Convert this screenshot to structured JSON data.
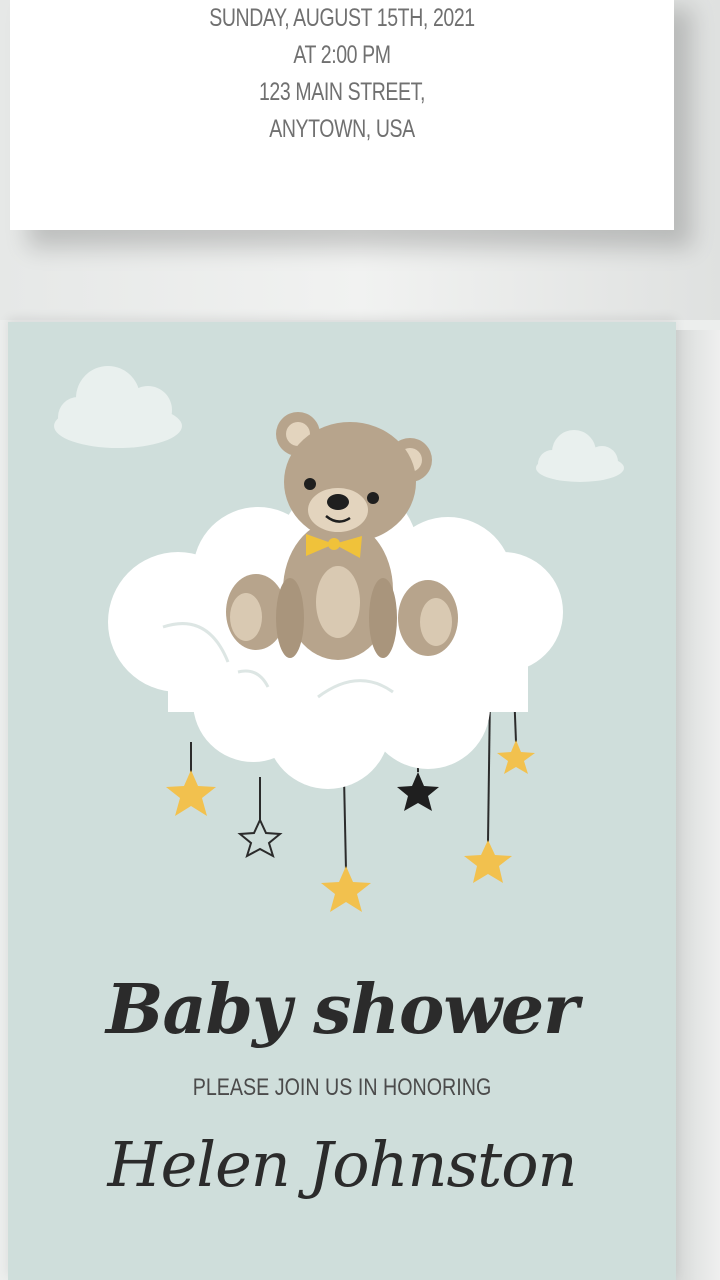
{
  "invitation_back": {
    "lines": [
      "SUNDAY, AUGUST 15TH, 2021",
      "AT 2:00 PM",
      "123 MAIN STREET,",
      "ANYTOWN, USA"
    ]
  },
  "invitation_front": {
    "heading": "Baby shower",
    "subheading": "PLEASE JOIN US IN HONORING",
    "honoree": "Helen Johnston"
  },
  "colors": {
    "card_background": "#cfdedb",
    "bear": "#b7a48c",
    "bow": "#f0c23a",
    "star_gold": "#f2c14e",
    "text_dark": "#2b2b2b"
  }
}
